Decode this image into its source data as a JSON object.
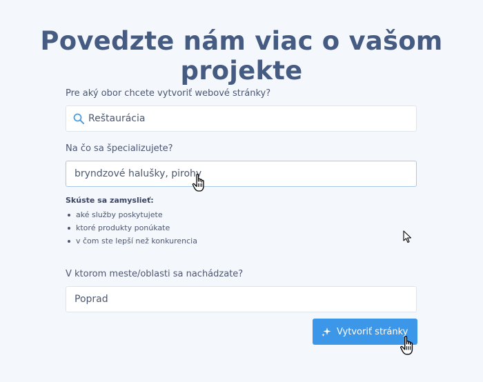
{
  "page": {
    "title": "Povedzte nám viac o vašom projekte"
  },
  "form": {
    "industry": {
      "label": "Pre aký obor chcete vytvoriť webové stránky?",
      "value": "Reštaurácia",
      "icon": "search-icon"
    },
    "specialization": {
      "label": "Na čo sa špecializujete?",
      "value": "bryndzové halušky, pirohy"
    },
    "tips": {
      "title": "Skúste sa zamyslieť:",
      "items": [
        "aké služby poskytujete",
        "ktoré produkty ponúkate",
        "v čom ste lepší než konkurencia"
      ]
    },
    "location": {
      "label": "V ktorom meste/oblasti sa nachádzate?",
      "value": "Poprad"
    },
    "submit": {
      "label": "Vytvoriť stránky",
      "icon": "sparkle-icon"
    }
  },
  "colors": {
    "title": "#465b82",
    "accent": "#3d97e8",
    "background": "#f4f7fc"
  }
}
